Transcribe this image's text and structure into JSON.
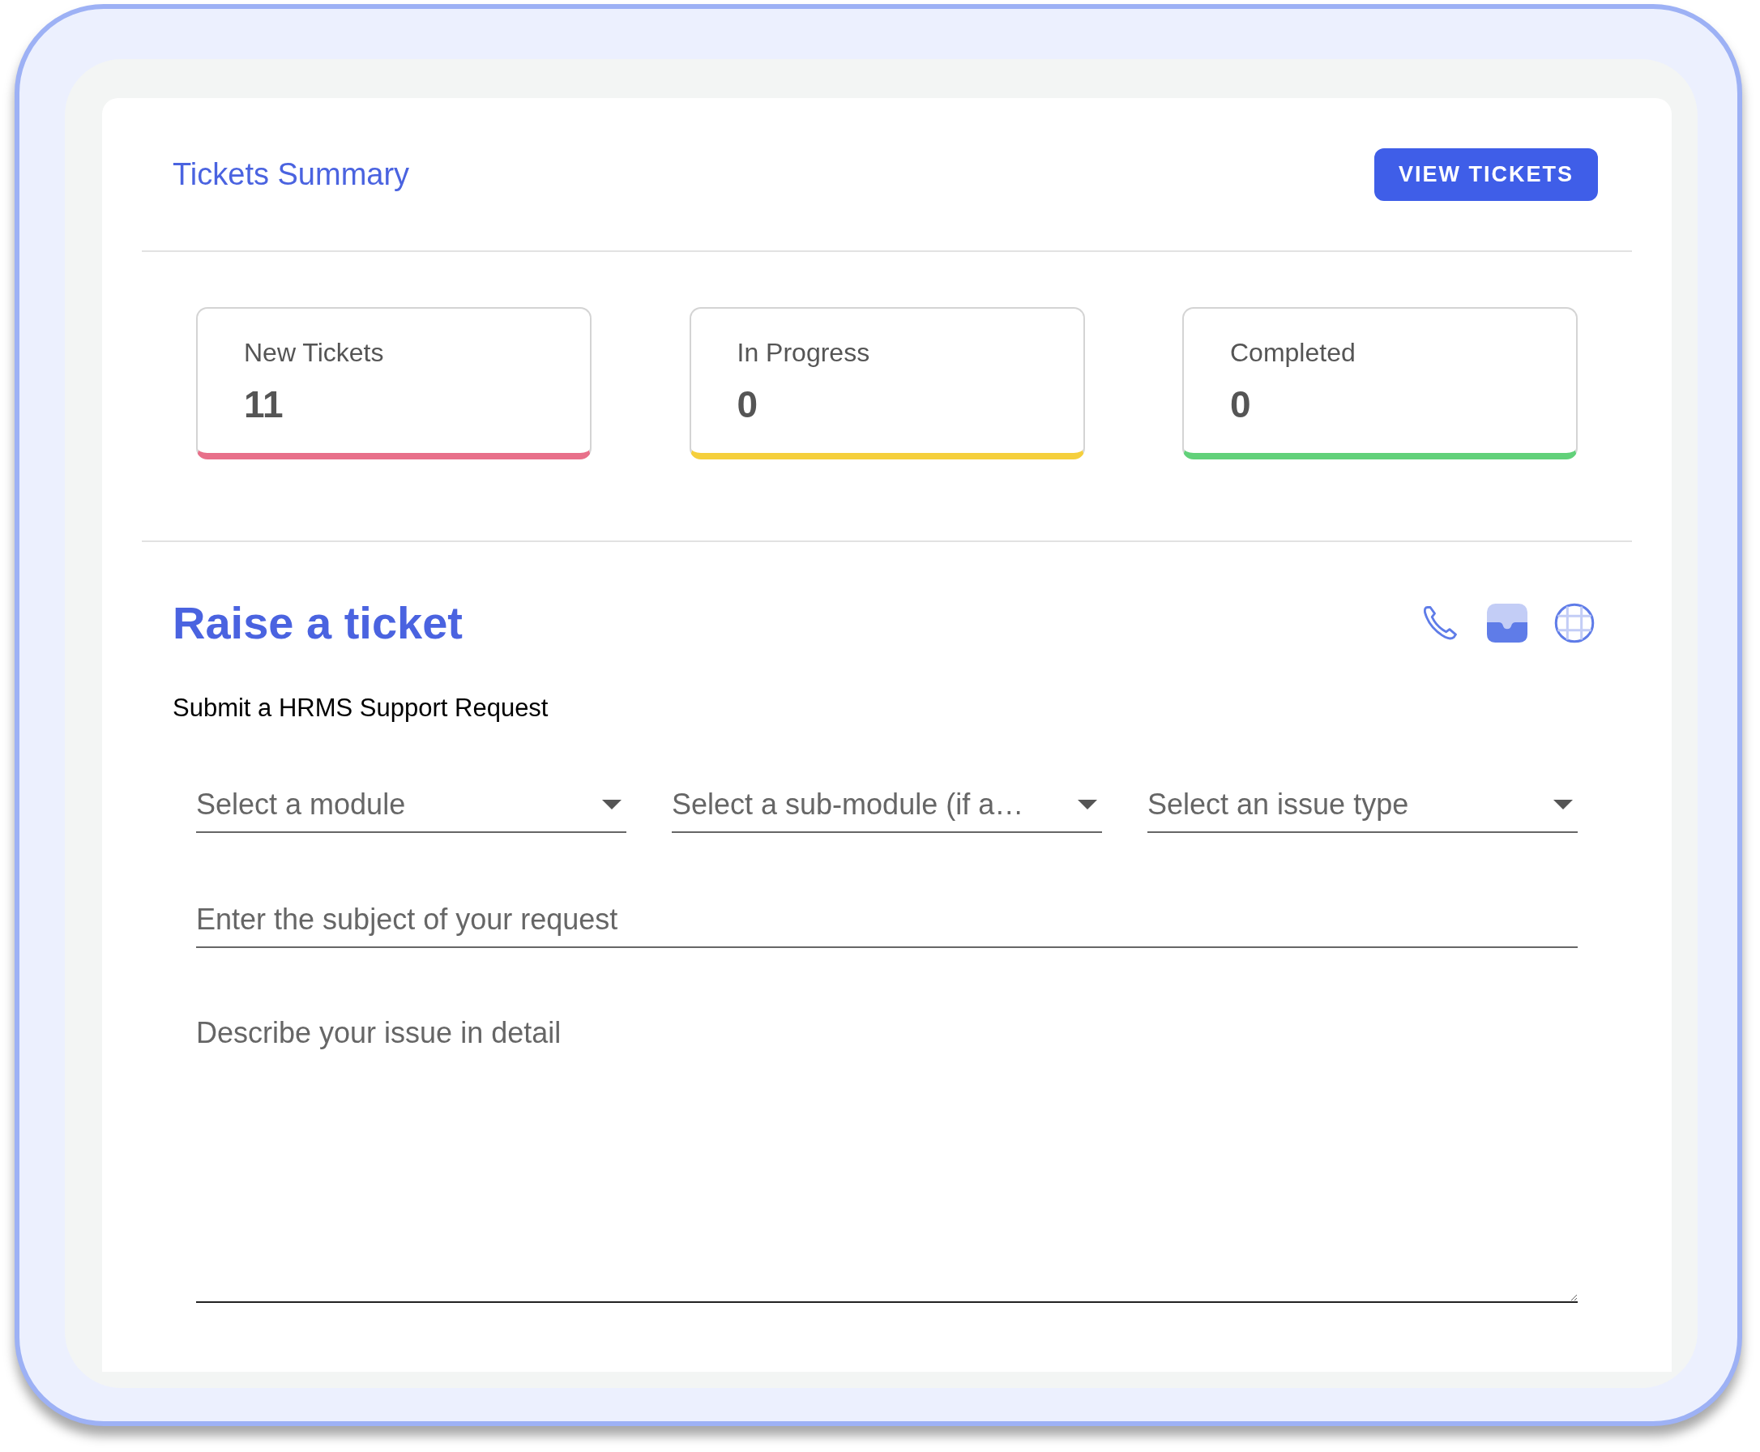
{
  "header": {
    "title": "Tickets Summary",
    "button": "VIEW TICKETS"
  },
  "cards": [
    {
      "label": "New Tickets",
      "value": "11",
      "color": "#e8708a"
    },
    {
      "label": "In Progress",
      "value": "0",
      "color": "#f5cf3c"
    },
    {
      "label": "Completed",
      "value": "0",
      "color": "#62d17a"
    }
  ],
  "form": {
    "title": "Raise a ticket",
    "subtitle": "Submit a HRMS Support Request",
    "selects": [
      {
        "placeholder": "Select a module"
      },
      {
        "placeholder": "Select a sub-module (if a…"
      },
      {
        "placeholder": "Select an issue type"
      }
    ],
    "subject": {
      "placeholder": "Enter the subject of your request"
    },
    "description": {
      "placeholder": "Describe your issue in detail"
    }
  }
}
